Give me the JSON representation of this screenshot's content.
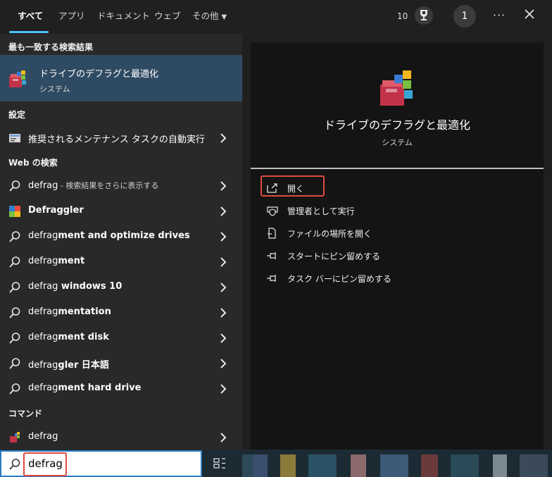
{
  "tabs": [
    {
      "label": "すべて"
    },
    {
      "label": "アプリ"
    },
    {
      "label": "ドキュメント"
    },
    {
      "label": "ウェブ"
    },
    {
      "label": "その他"
    }
  ],
  "header": {
    "points": "10",
    "avatar": "1"
  },
  "sections": {
    "best": "最も一致する検索結果",
    "settings": "設定",
    "web": "Web の検索",
    "commands": "コマンド"
  },
  "best_match": {
    "title": "ドライブのデフラグと最適化",
    "subtitle": "システム"
  },
  "settings_item": {
    "label": "推奨されるメンテナンス タスクの自動実行"
  },
  "web_results": [
    {
      "typed": "defrag",
      "rest": "",
      "muted": " - 検索結果をさらに表示する"
    },
    {
      "typed": "",
      "rest": "Defraggler",
      "muted": ""
    },
    {
      "typed": "defrag",
      "rest": "ment and optimize drives",
      "muted": ""
    },
    {
      "typed": "defrag",
      "rest": "ment",
      "muted": ""
    },
    {
      "typed": "defrag",
      "rest": " windows 10",
      "muted": ""
    },
    {
      "typed": "defrag",
      "rest": "mentation",
      "muted": ""
    },
    {
      "typed": "defrag",
      "rest": "ment disk",
      "muted": ""
    },
    {
      "typed": "defrag",
      "rest": "gler 日本語",
      "muted": ""
    },
    {
      "typed": "defrag",
      "rest": "ment hard drive",
      "muted": ""
    }
  ],
  "command_item": {
    "label": "defrag"
  },
  "detail": {
    "title": "ドライブのデフラグと最適化",
    "subtitle": "システム",
    "actions": [
      {
        "label": "開く",
        "icon": "open-icon"
      },
      {
        "label": "管理者として実行",
        "icon": "shield-icon"
      },
      {
        "label": "ファイルの場所を開く",
        "icon": "file-location-icon"
      },
      {
        "label": "スタートにピン留めする",
        "icon": "pin-icon"
      },
      {
        "label": "タスク バーにピン留めする",
        "icon": "pin-icon"
      }
    ]
  },
  "search": {
    "value": "defrag"
  },
  "colors": {
    "accent": "#4cc2ff",
    "highlight": "#e04a3f",
    "selected_row": "#2f4b63"
  }
}
